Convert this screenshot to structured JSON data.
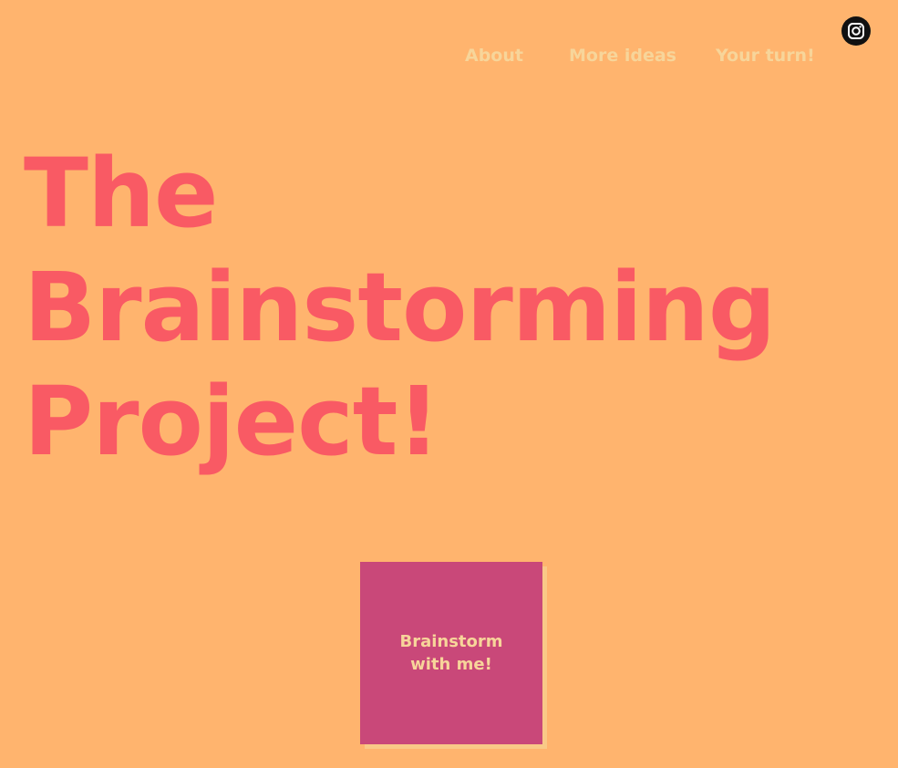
{
  "nav": {
    "items": [
      {
        "label": "About"
      },
      {
        "label": "More ideas"
      },
      {
        "label": "Your turn!"
      }
    ]
  },
  "social": {
    "icon": "instagram-icon"
  },
  "hero": {
    "title_lines": [
      "The",
      "Brainstorming",
      "Project!"
    ]
  },
  "cta": {
    "line1": "Brainstorm",
    "line2": "with me!"
  },
  "colors": {
    "background": "#FFB46E",
    "title": "#F95A64",
    "nav_text": "#F7D59A",
    "button": "#C94879",
    "button_shadow": "#F9C987"
  }
}
